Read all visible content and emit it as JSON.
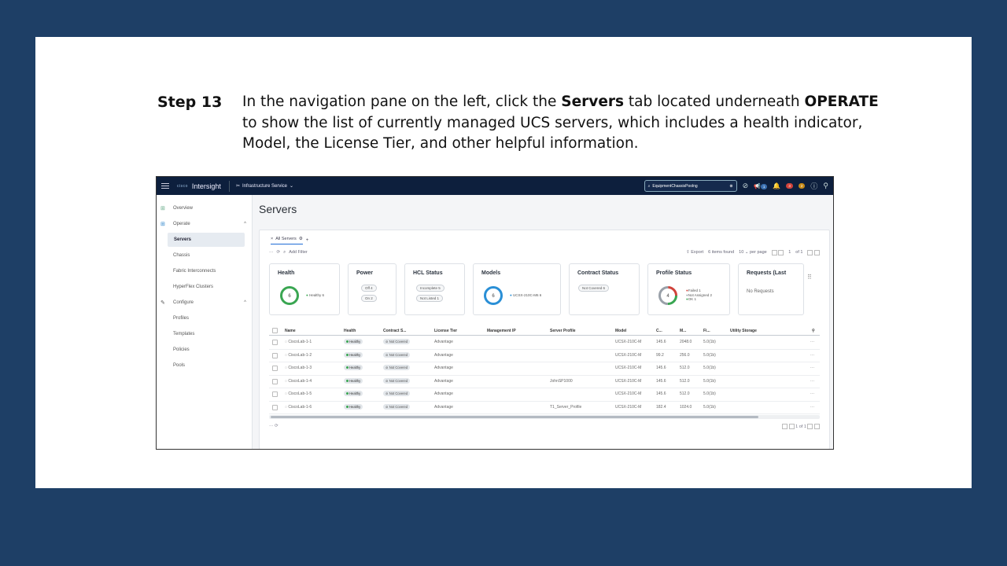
{
  "instruction": {
    "step_label": "Step 13",
    "text_1": "In the navigation pane on the left, click the ",
    "bold_1": "Servers",
    "text_2": " tab located underneath ",
    "bold_2": "OPERATE",
    "text_3": " to show the list of currently managed UCS servers, which includes a health indicator, Model, the License Tier, and other helpful information."
  },
  "topbar": {
    "app_name": "Intersight",
    "vendor": "cisco",
    "service": "Infrastructure Service",
    "search_value": "EquipmentChassisPoolng",
    "notif_count": "1",
    "alarm_critical": "3",
    "alarm_warning": "2",
    "icons": [
      "menu-icon",
      "service-icon",
      "search-icon",
      "clear-icon",
      "check-circle-icon",
      "megaphone-icon",
      "bell-icon",
      "help-icon",
      "user-icon"
    ]
  },
  "sidebar": {
    "items": [
      {
        "label": "Overview",
        "icon": "overview-icon"
      },
      {
        "label": "Operate",
        "icon": "operate-icon"
      },
      {
        "label": "Servers"
      },
      {
        "label": "Chassis"
      },
      {
        "label": "Fabric Interconnects"
      },
      {
        "label": "HyperFlex Clusters"
      },
      {
        "label": "Configure",
        "icon": "wrench-icon"
      },
      {
        "label": "Profiles"
      },
      {
        "label": "Templates"
      },
      {
        "label": "Policies"
      },
      {
        "label": "Pools"
      }
    ]
  },
  "main": {
    "title": "Servers",
    "tab_label": "All Servers",
    "filter_placeholder": "Add Filter",
    "export_label": "Export",
    "items_found": "6 items found",
    "per_page_value": "10",
    "per_page_label": "per page",
    "page_current": "1",
    "page_of": "of 1"
  },
  "cards": {
    "health": {
      "title": "Health",
      "center": "6",
      "legend": "Healthy 6",
      "color": "#3aa652"
    },
    "power": {
      "title": "Power",
      "pill1": "Off 4",
      "pill2": "On 2"
    },
    "hcl": {
      "title": "HCL Status",
      "pill1": "Incomplete 5",
      "pill2": "Not Listed 1"
    },
    "models": {
      "title": "Models",
      "center": "6",
      "legend": "UCSX-210C-M6 6",
      "color": "#2a8fd6"
    },
    "contract": {
      "title": "Contract Status",
      "pill1": "Not Covered 6"
    },
    "profile": {
      "title": "Profile Status",
      "center": "4",
      "legend1": "Failed 1",
      "legend2": "Not Assigned 2",
      "legend3": "OK 1"
    },
    "requests": {
      "title": "Requests (Last",
      "empty": "No Requests"
    }
  },
  "table": {
    "columns": [
      "Name",
      "Health",
      "Contract S...",
      "License Tier",
      "Management IP",
      "Server Profile",
      "Model",
      "C...",
      "M...",
      "Fi...",
      "Utility Storage"
    ],
    "rows": [
      {
        "name": "CiscoLab-1-1",
        "health": "Healthy",
        "contract": "Not Covered",
        "tier": "Advantage",
        "profile": "",
        "model": "UCSX-210C-M",
        "c": "145.6",
        "m": "2048.0",
        "fi": "5.0(1b)"
      },
      {
        "name": "CiscoLab-1-2",
        "health": "Healthy",
        "contract": "Not Covered",
        "tier": "Advantage",
        "profile": "",
        "model": "UCSX-210C-M",
        "c": "99.2",
        "m": "256.0",
        "fi": "5.0(1b)"
      },
      {
        "name": "CiscoLab-1-3",
        "health": "Healthy",
        "contract": "Not Covered",
        "tier": "Advantage",
        "profile": "",
        "model": "UCSX-210C-M",
        "c": "145.6",
        "m": "512.0",
        "fi": "5.0(1b)"
      },
      {
        "name": "CiscoLab-1-4",
        "health": "Healthy",
        "contract": "Not Covered",
        "tier": "Advantage",
        "profile": "JohnSP1000",
        "model": "UCSX-210C-M",
        "c": "145.6",
        "m": "512.0",
        "fi": "5.0(1b)"
      },
      {
        "name": "CiscoLab-1-5",
        "health": "Healthy",
        "contract": "Not Covered",
        "tier": "Advantage",
        "profile": "",
        "model": "UCSX-210C-M",
        "c": "145.6",
        "m": "512.0",
        "fi": "5.0(1b)"
      },
      {
        "name": "CiscoLab-1-6",
        "health": "Healthy",
        "contract": "Not Covered",
        "tier": "Advantage",
        "profile": "T1_Server_Profile",
        "model": "UCSX-210C-M",
        "c": "182.4",
        "m": "1024.0",
        "fi": "5.0(1b)"
      }
    ]
  },
  "footer": {
    "page_current": "1",
    "page_of": "of 1"
  }
}
